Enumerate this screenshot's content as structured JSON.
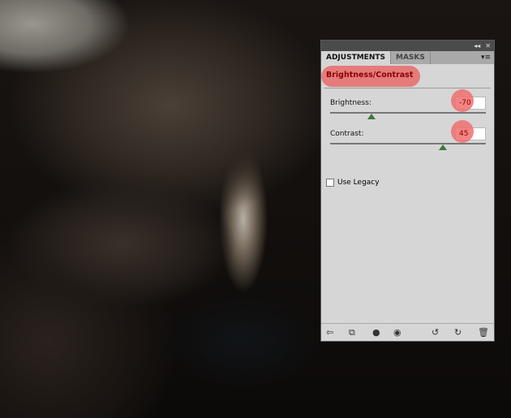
{
  "panel": {
    "title_controls": [
      "collapse-icon",
      "close-icon"
    ],
    "tabs": [
      {
        "label": "ADJUSTMENTS",
        "active": true
      },
      {
        "label": "MASKS",
        "active": false
      }
    ],
    "header": "Brightness/Contrast",
    "brightness": {
      "label": "Brightness:",
      "value": "-70",
      "num": -70,
      "range": [
        -150,
        150
      ]
    },
    "contrast": {
      "label": "Contrast:",
      "value": "45",
      "num": 45,
      "range": [
        -100,
        100
      ]
    },
    "legacy": {
      "label": "Use Legacy",
      "checked": false
    },
    "footer_icons": [
      "back-arrow-icon",
      "expand-view-icon",
      "clip-layer-icon",
      "visibility-eye-icon",
      "view-previous-icon",
      "reset-icon",
      "trash-icon"
    ]
  },
  "accent": "#e86464"
}
